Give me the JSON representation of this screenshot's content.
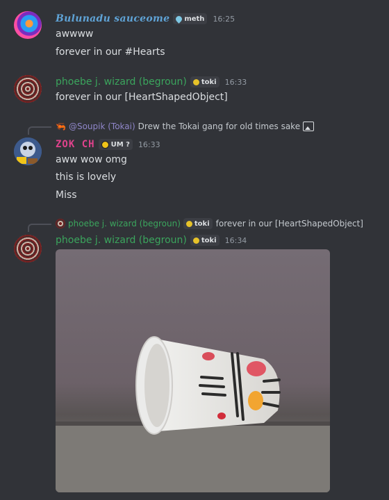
{
  "messages": [
    {
      "username": "Bulunadu sauceome",
      "tag": "meth",
      "tag_icon": "droplet-icon",
      "time": "16:25",
      "lines": [
        "awwww",
        "forever in our #Hearts"
      ]
    },
    {
      "username": "phoebe j. wizard (begroun)",
      "tag": "toki",
      "tag_icon": "lemon-icon",
      "time": "16:33",
      "lines": [
        "forever in our [HeartShapedObject]"
      ]
    },
    {
      "reply": {
        "author": "@Soupik (Tokai)",
        "text": "Drew the Tokai gang for old times sake",
        "has_image": true
      },
      "username": "ZOK CH",
      "tag": "UM ?",
      "tag_icon": "emoji-icon",
      "time": "16:33",
      "lines": [
        "aww wow omg",
        "this is lovely",
        "Miss"
      ]
    },
    {
      "reply": {
        "author": "phoebe j. wizard (begroun)",
        "tag": "toki",
        "text": "forever in our [HeartShapedObject]"
      },
      "username": "phoebe j. wizard (begroun)",
      "tag": "toki",
      "tag_icon": "lemon-icon",
      "time": "16:34",
      "attachment": "photo of a fallen paper cup painted with a face"
    }
  ],
  "colors": {
    "background": "#313338",
    "sauce_name": "#5fa3d6",
    "phoebe_name": "#3ba55d",
    "zok_name": "#e0428c",
    "soupik_name": "#8f86c9"
  }
}
